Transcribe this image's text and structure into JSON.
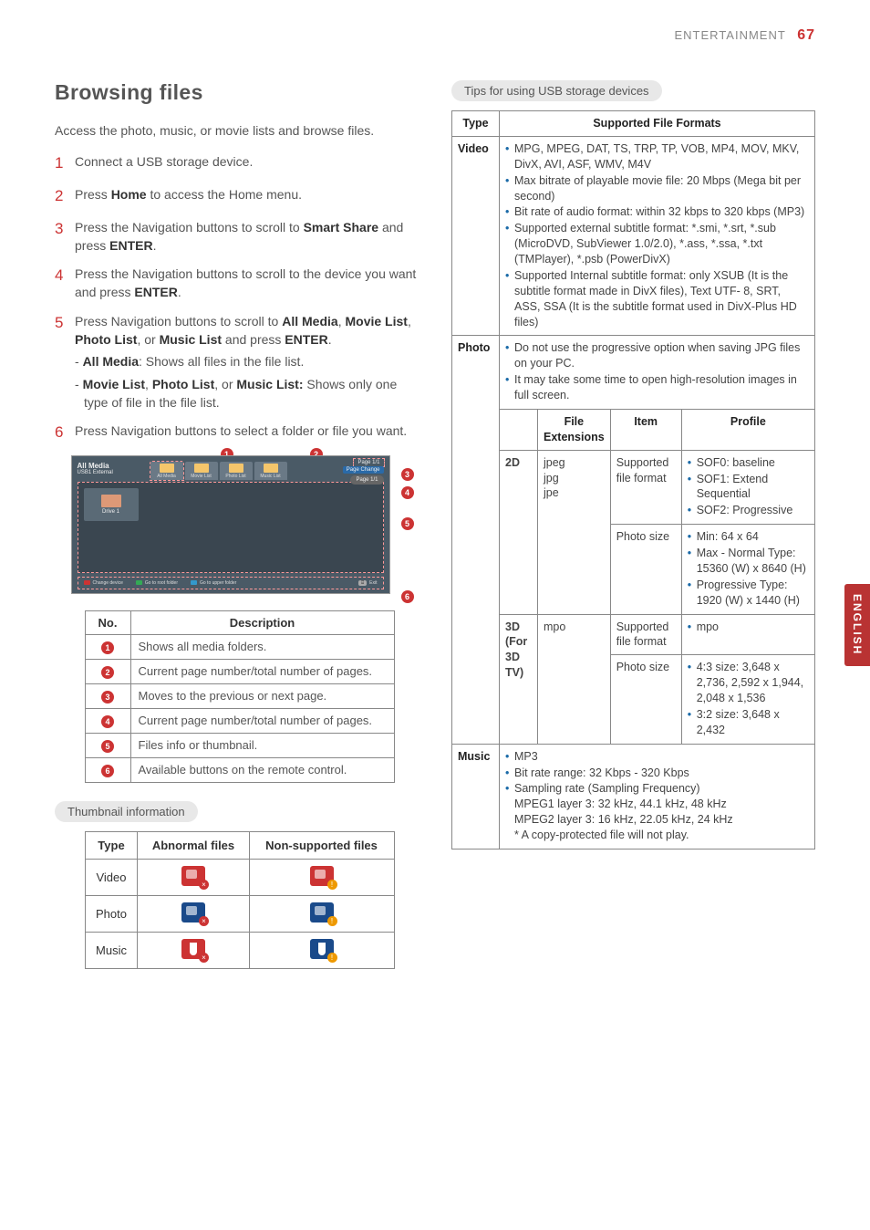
{
  "header": {
    "section": "ENTERTAINMENT",
    "page": "67"
  },
  "sideTab": "ENGLISH",
  "title": "Browsing files",
  "intro": "Access the photo, music, or movie lists and browse files.",
  "steps": [
    {
      "n": "1",
      "body": "Connect a USB storage device."
    },
    {
      "n": "2",
      "bodyPre": "Press ",
      "bold1": "Home",
      "bodyMid": " to access the Home menu."
    },
    {
      "n": "3",
      "bodyPre": "Press the Navigation buttons to scroll to ",
      "bold1": "Smart Share",
      "bodyMid": " and press ",
      "bold2": "ENTER",
      "bodyEnd": "."
    },
    {
      "n": "4",
      "bodyPre": "Press the Navigation buttons to scroll to the device you want and press ",
      "bold1": "ENTER",
      "bodyEnd": "."
    },
    {
      "n": "5",
      "bodyPre": "Press Navigation buttons to scroll to ",
      "bold1": "All Media",
      "bodyMid": ", ",
      "bold2": "Movie List",
      "bodyMid2": ", ",
      "bold3": "Photo List",
      "bodyMid3": ", or ",
      "bold4": "Music List",
      "bodyMid4": " and press ",
      "bold5": "ENTER",
      "bodyEnd": ".",
      "subs": [
        {
          "boldLead": "All Media",
          "rest": ": Shows all files in the file list."
        },
        {
          "boldLead": "Movie List",
          "mid": ", ",
          "bold2": "Photo List",
          "mid2": ", or ",
          "bold3": "Music List:",
          "rest": "  Shows only one type of file in the file list."
        }
      ]
    },
    {
      "n": "6",
      "body": "Press Navigation buttons to select a folder or file you want."
    }
  ],
  "mock": {
    "side1": "All Media",
    "side2": "USB1 External",
    "tabs": [
      "All Media",
      "Movie List",
      "Photo List",
      "Music List"
    ],
    "pageLine1": "Page 1/1",
    "pageChange": "Page Change",
    "pageLine2": "Page 1/1",
    "drive": "Drive 1",
    "foot": {
      "change": "Change device",
      "root": "Go to root folder",
      "upper": "Go to upper folder",
      "exit": "Exit"
    }
  },
  "descTable": {
    "h1": "No.",
    "h2": "Description",
    "rows": [
      {
        "n": "1",
        "d": "Shows all media folders."
      },
      {
        "n": "2",
        "d": "Current page number/total number of pages."
      },
      {
        "n": "3",
        "d": "Moves to the previous or next page."
      },
      {
        "n": "4",
        "d": "Current page number/total number of pages."
      },
      {
        "n": "5",
        "d": "Files info or thumbnail."
      },
      {
        "n": "6",
        "d": "Available buttons on the remote control."
      }
    ]
  },
  "thumbPill": "Thumbnail information",
  "thumbTable": {
    "h1": "Type",
    "h2": "Abnormal files",
    "h3": "Non-supported files",
    "rows": [
      "Video",
      "Photo",
      "Music"
    ]
  },
  "tipsPill": "Tips for using USB storage devices",
  "fmt": {
    "hType": "Type",
    "hSupported": "Supported File Formats",
    "video": {
      "label": "Video",
      "bullets": [
        "MPG, MPEG, DAT, TS, TRP, TP, VOB, MP4, MOV, MKV, DivX, AVI, ASF, WMV, M4V",
        "Max bitrate of playable movie file: 20 Mbps (Mega bit per second)",
        "Bit rate of audio format: within 32 kbps to 320 kbps (MP3)",
        "Supported external subtitle format: *.smi, *.srt, *.sub (MicroDVD, SubViewer 1.0/2.0), *.ass, *.ssa, *.txt (TMPlayer), *.psb (PowerDivX)",
        "Supported Internal subtitle format: only XSUB (It is the subtitle format made in DivX files), Text UTF- 8, SRT, ASS, SSA (It is the subtitle format used in DivX-Plus HD files)"
      ]
    },
    "photo": {
      "label": "Photo",
      "topBullets": [
        "Do not use the progressive option when saving JPG files on your PC.",
        "It may take some time to open high-resolution images in full screen."
      ],
      "innerHeads": {
        "ext": "File Extensions",
        "item": "Item",
        "profile": "Profile"
      },
      "row2d": {
        "label": "2D",
        "ext": "jpeg\njpg\njpe",
        "item1": "Supported file format",
        "profile1": [
          "SOF0: baseline",
          "SOF1: Extend Sequential",
          "SOF2: Progressive"
        ],
        "item2": "Photo size",
        "profile2": [
          "Min: 64 x 64",
          "Max - Normal Type: 15360 (W) x 8640 (H)",
          "Progressive Type: 1920 (W) x 1440 (H)"
        ]
      },
      "row3d": {
        "label": "3D\n(For 3D TV)",
        "ext": "mpo",
        "item1": "Supported file format",
        "profile1": [
          "mpo"
        ],
        "item2": "Photo size",
        "profile2": [
          "4:3 size: 3,648 x 2,736, 2,592 x 1,944, 2,048 x 1,536",
          "3:2 size: 3,648 x 2,432"
        ]
      }
    },
    "music": {
      "label": "Music",
      "bullets": [
        "MP3",
        "Bit rate range: 32 Kbps - 320 Kbps",
        "Sampling rate (Sampling Frequency)\nMPEG1 layer 3: 32 kHz, 44.1 kHz, 48 kHz\nMPEG2 layer 3: 16 kHz, 22.05 kHz, 24 kHz\n* A copy-protected file will not play."
      ]
    }
  }
}
